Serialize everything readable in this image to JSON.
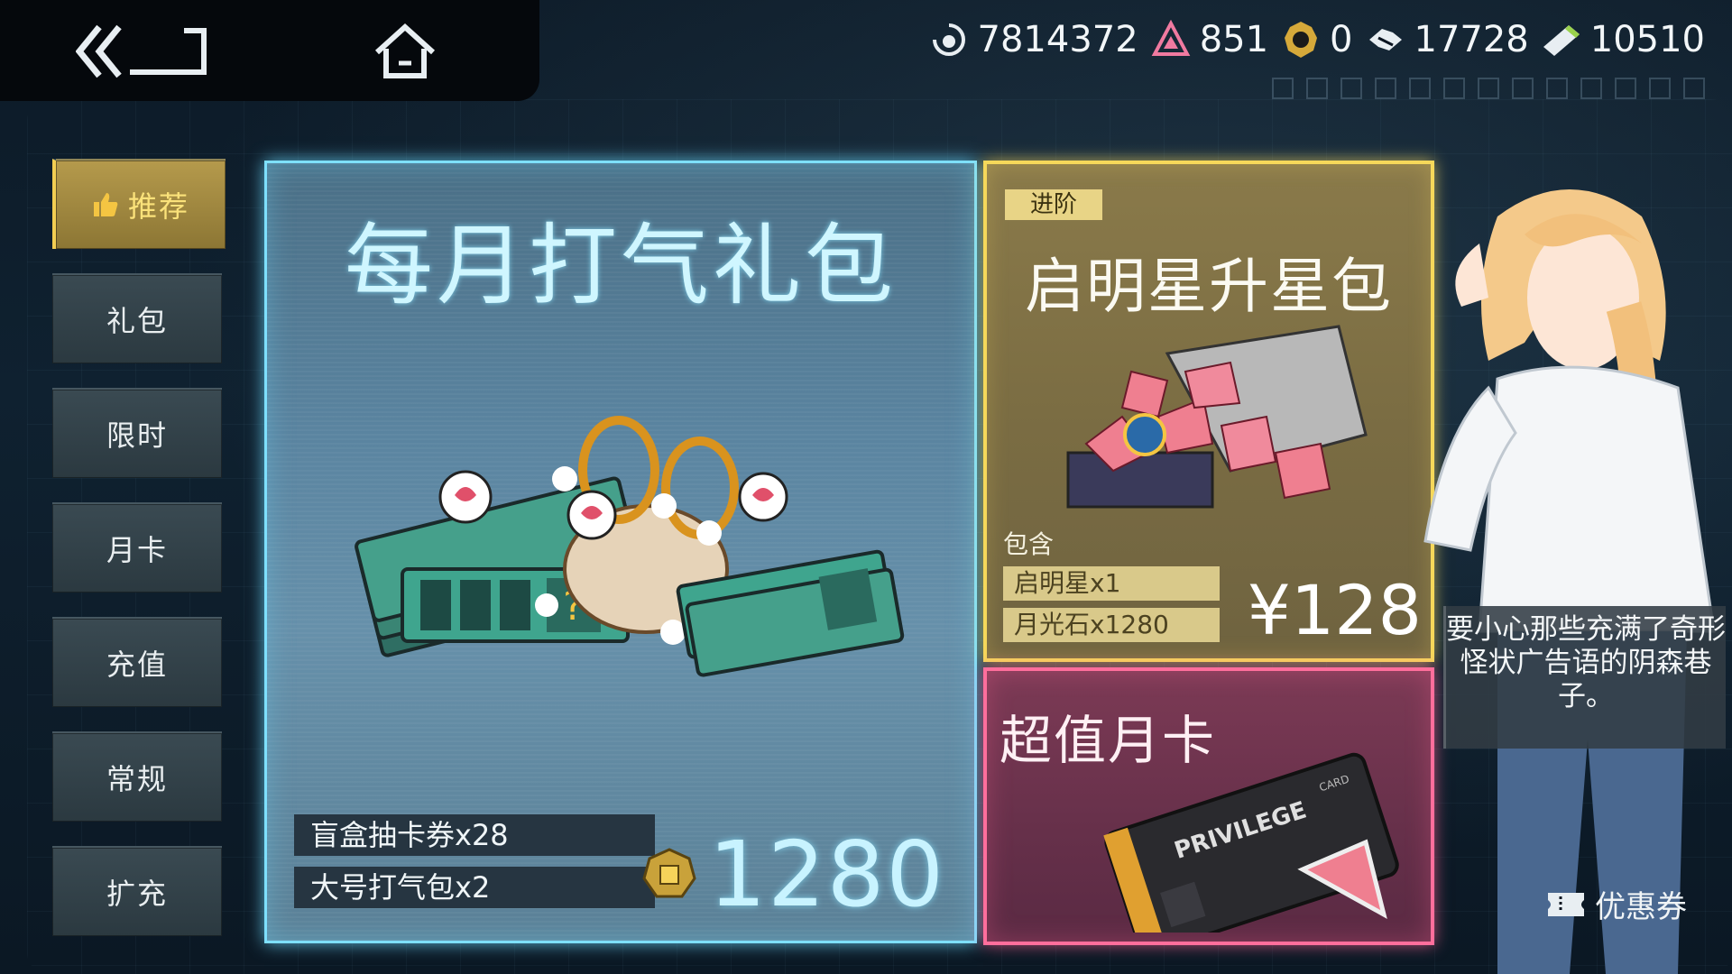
{
  "currencies": [
    {
      "icon": "currency-swirl-icon",
      "value": "7814372"
    },
    {
      "icon": "currency-crystal-icon",
      "value": "851"
    },
    {
      "icon": "currency-gear-coin-icon",
      "value": "0"
    },
    {
      "icon": "currency-handshake-icon",
      "value": "17728"
    },
    {
      "icon": "currency-guild-ticket-icon",
      "value": "10510"
    }
  ],
  "sidebar": {
    "items": [
      {
        "label": "推荐",
        "active": true
      },
      {
        "label": "礼包"
      },
      {
        "label": "限时"
      },
      {
        "label": "月卡"
      },
      {
        "label": "充值"
      },
      {
        "label": "常规"
      },
      {
        "label": "扩充"
      }
    ]
  },
  "main_pack": {
    "title": "每月打气礼包",
    "items": [
      "盲盒抽卡券x28",
      "大号打气包x2"
    ],
    "price": "1280",
    "price_icon": "gem-currency-icon",
    "colors": {
      "border": "#7ee0ff"
    }
  },
  "star_pack": {
    "tag": "进阶",
    "title": "启明星升星包",
    "contains_label": "包含",
    "items": [
      "启明星x1",
      "月光石x1280"
    ],
    "price": "¥128",
    "colors": {
      "border": "#f6d85a"
    }
  },
  "month_card": {
    "title": "超值月卡",
    "card_text": "PRIVILEGE",
    "card_sub": "CARD",
    "colors": {
      "border": "#ff6e9c"
    }
  },
  "character": {
    "speech": "要小心那些充满了奇形怪状广告语的阴森巷子。"
  },
  "coupon": {
    "label": "优惠券"
  }
}
